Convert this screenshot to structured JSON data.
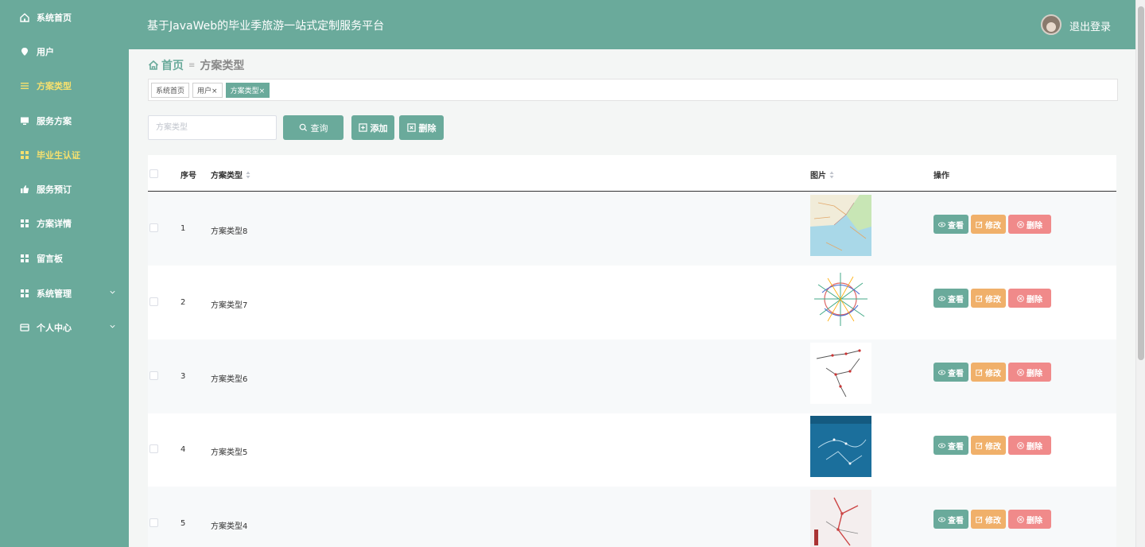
{
  "sidebar": {
    "items": [
      {
        "label": "系统首页",
        "icon": "home-icon"
      },
      {
        "label": "用户",
        "icon": "location-pin-icon"
      },
      {
        "label": "方案类型",
        "icon": "list-icon",
        "active": true
      },
      {
        "label": "服务方案",
        "icon": "monitor-icon"
      },
      {
        "label": "毕业生认证",
        "icon": "grid-icon"
      },
      {
        "label": "服务预订",
        "icon": "thumb-up-icon"
      },
      {
        "label": "方案详情",
        "icon": "grid-icon"
      },
      {
        "label": "留言板",
        "icon": "grid-icon"
      },
      {
        "label": "系统管理",
        "icon": "grid-icon",
        "expandable": true
      },
      {
        "label": "个人中心",
        "icon": "card-icon",
        "expandable": true
      }
    ]
  },
  "header": {
    "title": "基于JavaWeb的毕业季旅游一站式定制服务平台",
    "logout_label": "退出登录"
  },
  "breadcrumb": {
    "home": "首页",
    "current": "方案类型"
  },
  "tags": [
    {
      "label": "系统首页"
    },
    {
      "label": "用户×"
    },
    {
      "label": "方案类型×",
      "active": true
    }
  ],
  "toolbar": {
    "search_placeholder": "方案类型",
    "query_label": "查询",
    "add_label": "添加",
    "delete_label": "删除"
  },
  "table": {
    "columns": {
      "index": "序号",
      "type": "方案类型",
      "image": "图片",
      "actions": "操作"
    },
    "rows": [
      {
        "index": "1",
        "type": "方案类型8"
      },
      {
        "index": "2",
        "type": "方案类型7"
      },
      {
        "index": "3",
        "type": "方案类型6"
      },
      {
        "index": "4",
        "type": "方案类型5"
      },
      {
        "index": "5",
        "type": "方案类型4"
      }
    ],
    "actions": {
      "view": "查看",
      "edit": "修改",
      "delete": "删除"
    }
  },
  "colors": {
    "primary": "#6aaa9b",
    "active_menu": "#f6e06e",
    "edit": "#f0b06a",
    "delete": "#f08a8a"
  }
}
